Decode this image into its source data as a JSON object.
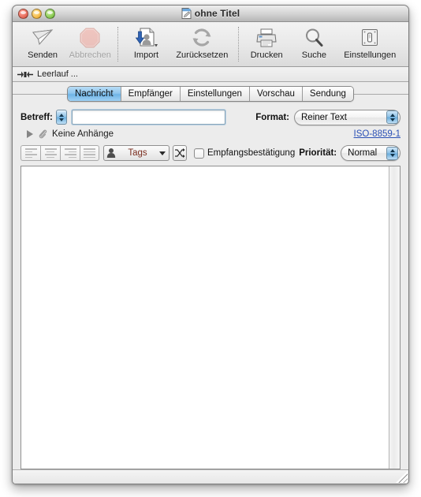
{
  "window": {
    "title": "ohne Titel",
    "title_icon": "document-pencil-icon",
    "traffic_lights": {
      "close": "close-button",
      "minimize": "minimize-button",
      "zoom": "zoom-button"
    }
  },
  "toolbar": {
    "items": [
      {
        "label": "Senden",
        "icon": "paper-plane-icon",
        "enabled": true
      },
      {
        "label": "Abbrechen",
        "icon": "stop-octagon-icon",
        "enabled": false
      },
      {
        "label": "Import",
        "icon": "import-contact-icon",
        "enabled": true
      },
      {
        "label": "Zurücksetzen",
        "icon": "refresh-arrows-icon",
        "enabled": true
      },
      {
        "label": "Drucken",
        "icon": "printer-icon",
        "enabled": true
      },
      {
        "label": "Suche",
        "icon": "magnifier-icon",
        "enabled": true
      },
      {
        "label": "Einstellungen",
        "icon": "switch-plate-icon",
        "enabled": true
      }
    ]
  },
  "status": {
    "icon": "connection-icon",
    "text": "Leerlauf ..."
  },
  "tabs": [
    {
      "label": "Nachricht",
      "active": true
    },
    {
      "label": "Empfänger",
      "active": false
    },
    {
      "label": "Einstellungen",
      "active": false
    },
    {
      "label": "Vorschau",
      "active": false
    },
    {
      "label": "Sendung",
      "active": false
    }
  ],
  "fields": {
    "subject_label": "Betreff:",
    "subject_value": "",
    "subject_placeholder": "",
    "format_label": "Format:",
    "format_value": "Reiner Text",
    "format_options": [
      "Reiner Text"
    ],
    "attachments_text": "Keine Anhänge",
    "attachments_icon": "paperclip-icon",
    "encoding_link": "ISO-8859-1"
  },
  "formatbar": {
    "align_buttons": [
      {
        "name": "align-left-button",
        "enabled": false
      },
      {
        "name": "align-center-button",
        "enabled": false
      },
      {
        "name": "align-right-button",
        "enabled": false
      },
      {
        "name": "align-justify-button",
        "enabled": false
      }
    ],
    "tags_label": "Tags",
    "tags_icon": "person-icon",
    "shuffle_icon": "shuffle-arrows-icon",
    "receipt_label": "Empfangsbestätigung",
    "receipt_checked": false,
    "priority_label": "Priorität:",
    "priority_value": "Normal",
    "priority_options": [
      "Normal"
    ]
  },
  "editor": {
    "body_text": ""
  },
  "colors": {
    "accent_blue": "#6fb4e6",
    "link_blue": "#2a4fb5",
    "tag_red": "#7a2d1e",
    "window_bg": "#ededed",
    "disabled_gray": "#a3a3a3"
  }
}
